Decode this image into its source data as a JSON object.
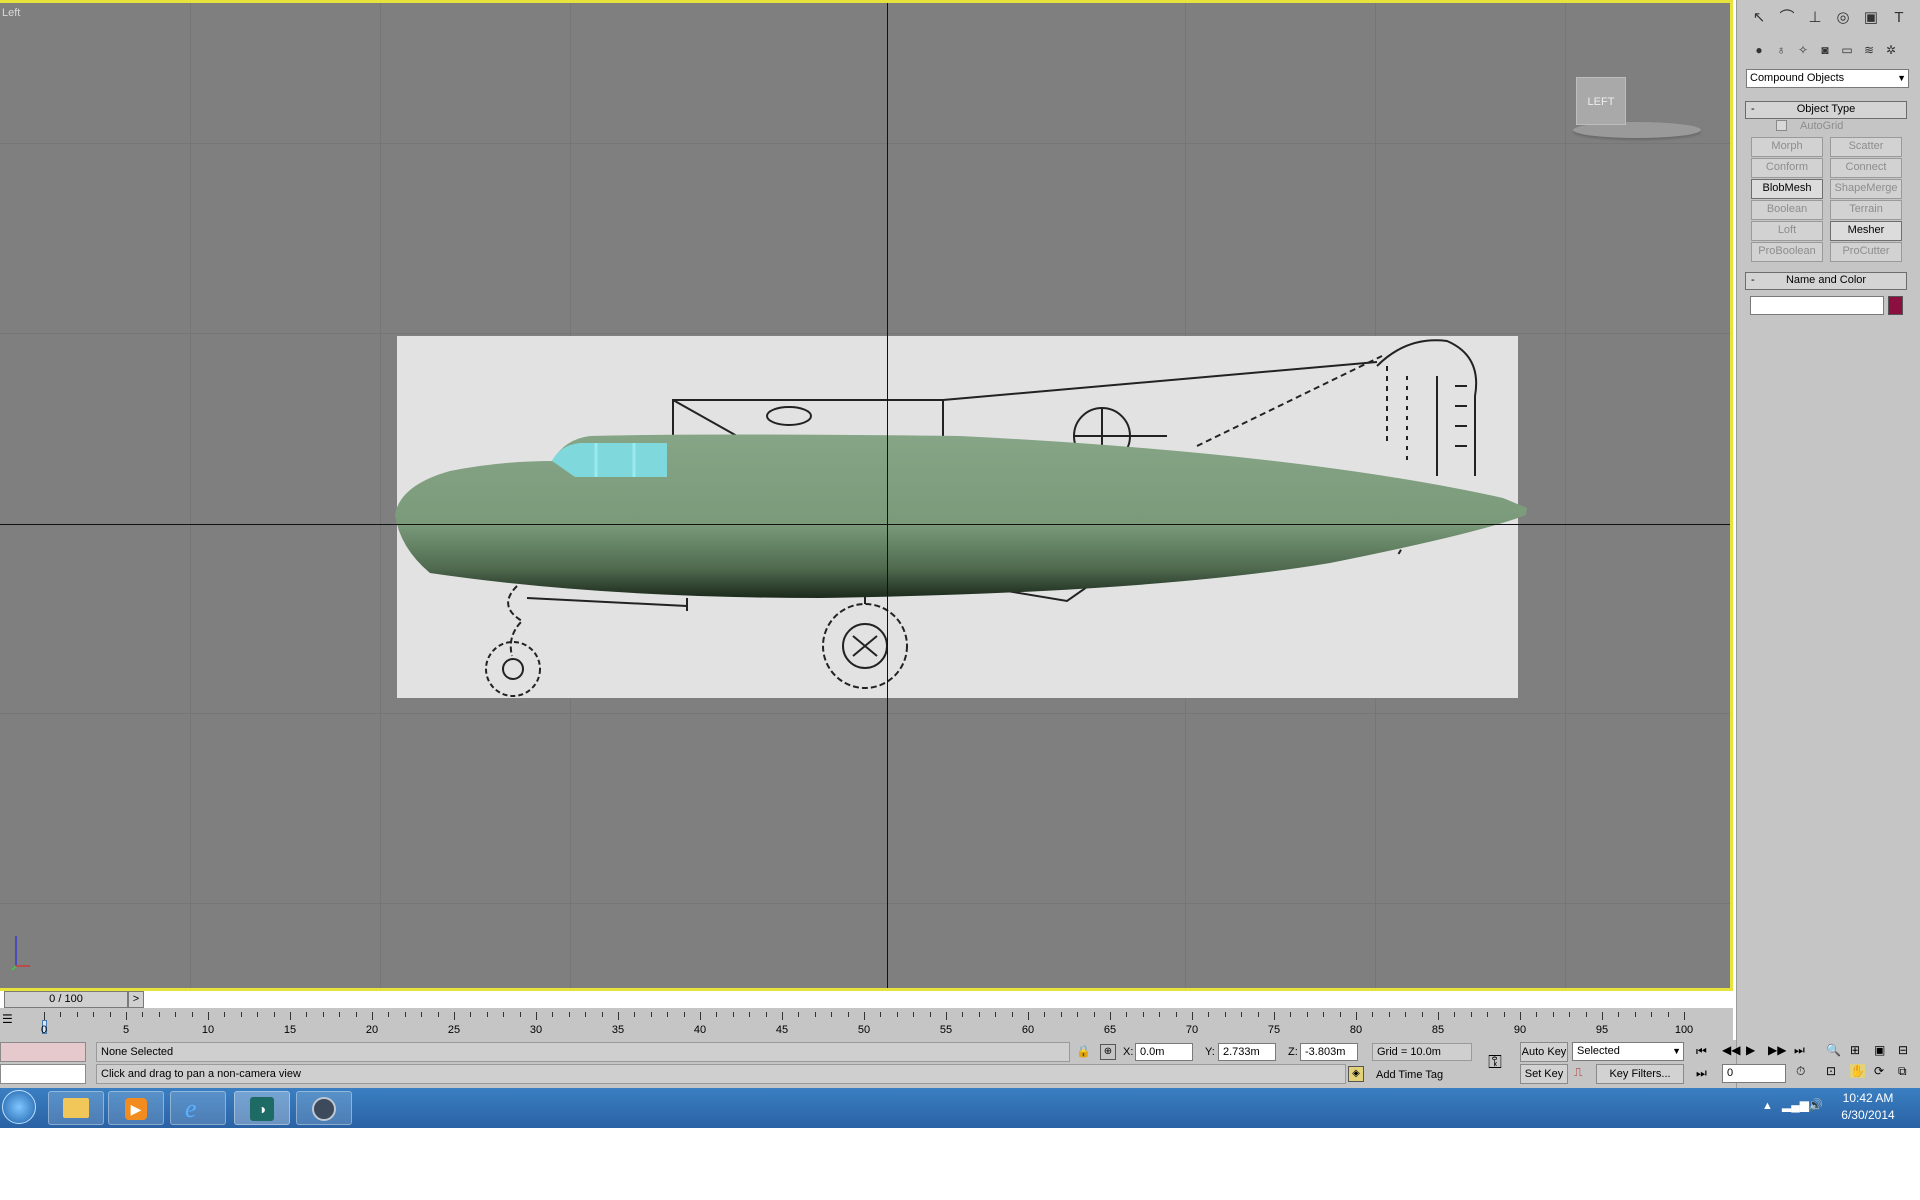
{
  "viewport": {
    "label": "Left",
    "viewcube_label": "LEFT"
  },
  "command_panel": {
    "category_dropdown": "Compound Objects",
    "object_type_rollout": {
      "title": "Object Type",
      "autogrid_label": "AutoGrid",
      "buttons": [
        "Morph",
        "Scatter",
        "Conform",
        "Connect",
        "BlobMesh",
        "ShapeMerge",
        "Boolean",
        "Terrain",
        "Loft",
        "Mesher",
        "ProBoolean",
        "ProCutter"
      ]
    },
    "name_color_rollout": {
      "title": "Name and Color",
      "name_value": "",
      "color": "#8b1040"
    },
    "rollout_toggle": "-"
  },
  "time_slider": {
    "label": "0 / 100",
    "next_glyph": ">"
  },
  "trackbar": {
    "ticks": [
      "0",
      "5",
      "10",
      "15",
      "20",
      "25",
      "30",
      "35",
      "40",
      "45",
      "50",
      "55",
      "60",
      "65",
      "70",
      "75",
      "80",
      "85",
      "90",
      "95",
      "100"
    ]
  },
  "status": {
    "selection": "None Selected",
    "prompt": "Click and drag to pan a non-camera view",
    "x_label": "X:",
    "x_value": "0.0m",
    "y_label": "Y:",
    "y_value": "2.733m",
    "z_label": "Z:",
    "z_value": "-3.803m",
    "grid": "Grid = 10.0m",
    "add_time_tag": "Add Time Tag",
    "auto_key": "Auto Key",
    "set_key": "Set Key",
    "key_mode": "Selected",
    "key_filters": "Key Filters...",
    "frame": "0"
  },
  "taskbar": {
    "time": "10:42 AM",
    "date": "6/30/2014"
  },
  "colors": {
    "viewport_bg": "#7f7f7f",
    "active_border": "#e8e33a",
    "fuselage": "#7fa07f",
    "canopy": "#7fd8dc",
    "taskbar": "#2f6fb3"
  }
}
